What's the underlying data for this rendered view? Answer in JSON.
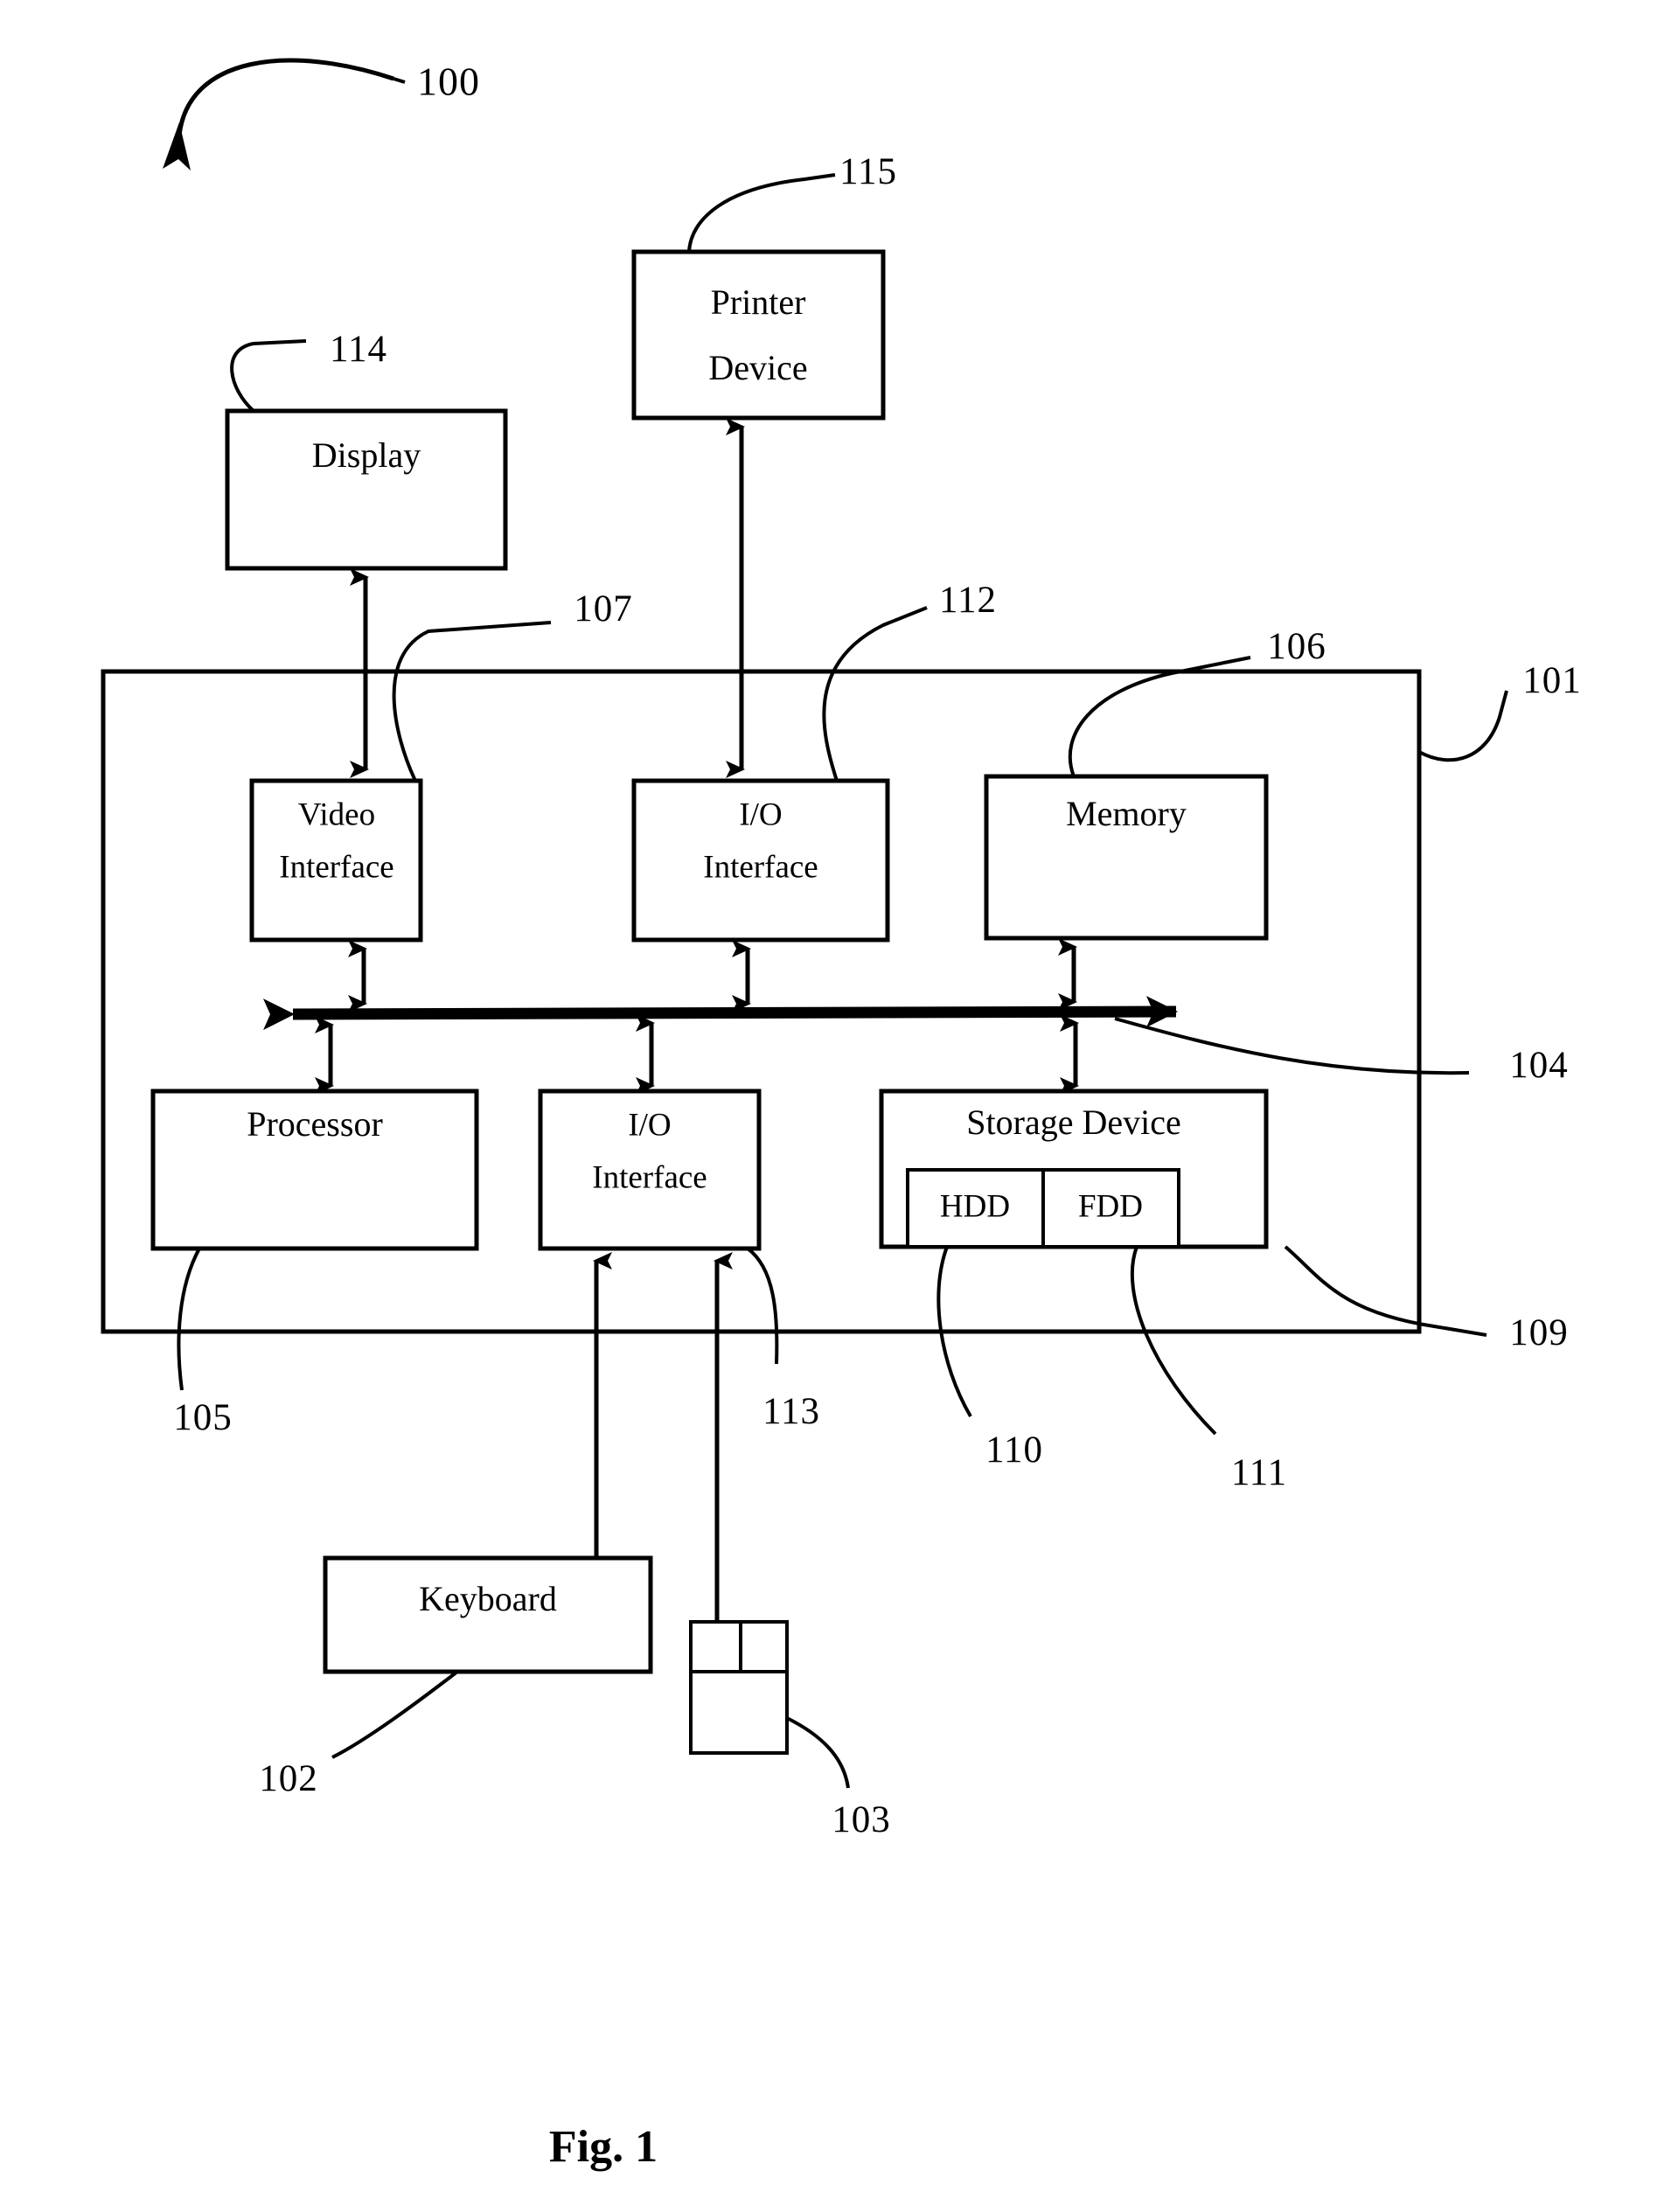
{
  "figure": {
    "caption": "Fig. 1",
    "system_ref": "100"
  },
  "boxes": [
    {
      "id": "printer-device",
      "label_line1": "Printer",
      "label_line2": "Device",
      "ref": "115"
    },
    {
      "id": "display",
      "label_line1": "Display",
      "label_line2": "",
      "ref": "114"
    },
    {
      "id": "video-interface",
      "label_line1": "Video",
      "label_line2": "Interface",
      "ref": "107"
    },
    {
      "id": "io-interface-top",
      "label_line1": "I/O",
      "label_line2": "Interface",
      "ref": "112"
    },
    {
      "id": "memory",
      "label_line1": "Memory",
      "label_line2": "",
      "ref": "106"
    },
    {
      "id": "processor",
      "label_line1": "Processor",
      "label_line2": "",
      "ref": "105"
    },
    {
      "id": "io-interface-bottom",
      "label_line1": "I/O",
      "label_line2": "Interface",
      "ref": "113"
    },
    {
      "id": "storage-device",
      "label_line1": "Storage Device",
      "label_line2": "",
      "ref": "109"
    },
    {
      "id": "hdd",
      "label_line1": "HDD",
      "label_line2": "",
      "ref": "110"
    },
    {
      "id": "fdd",
      "label_line1": "FDD",
      "label_line2": "",
      "ref": "111"
    },
    {
      "id": "keyboard",
      "label_line1": "Keyboard",
      "label_line2": "",
      "ref": "102"
    },
    {
      "id": "mouse",
      "label_line1": "",
      "label_line2": "",
      "ref": "103"
    },
    {
      "id": "enclosure",
      "label_line1": "",
      "label_line2": "",
      "ref": "101"
    },
    {
      "id": "bus",
      "label_line1": "",
      "label_line2": "",
      "ref": "104"
    }
  ],
  "labels": {
    "printer_line1": "Printer",
    "printer_line2": "Device",
    "display": "Display",
    "video_line1": "Video",
    "video_line2": "Interface",
    "io_top_line1": "I/O",
    "io_top_line2": "Interface",
    "memory": "Memory",
    "processor": "Processor",
    "io_bottom_line1": "I/O",
    "io_bottom_line2": "Interface",
    "storage_device": "Storage Device",
    "hdd": "HDD",
    "fdd": "FDD",
    "keyboard": "Keyboard"
  },
  "refs": {
    "system": "100",
    "enclosure": "101",
    "keyboard": "102",
    "mouse": "103",
    "bus": "104",
    "processor": "105",
    "memory": "106",
    "video_interface": "107",
    "storage_device": "109",
    "hdd": "110",
    "fdd": "111",
    "io_interface_top": "112",
    "io_interface_bottom": "113",
    "display": "114",
    "printer_device": "115"
  },
  "colors": {
    "line": "#000000",
    "background": "#ffffff"
  }
}
